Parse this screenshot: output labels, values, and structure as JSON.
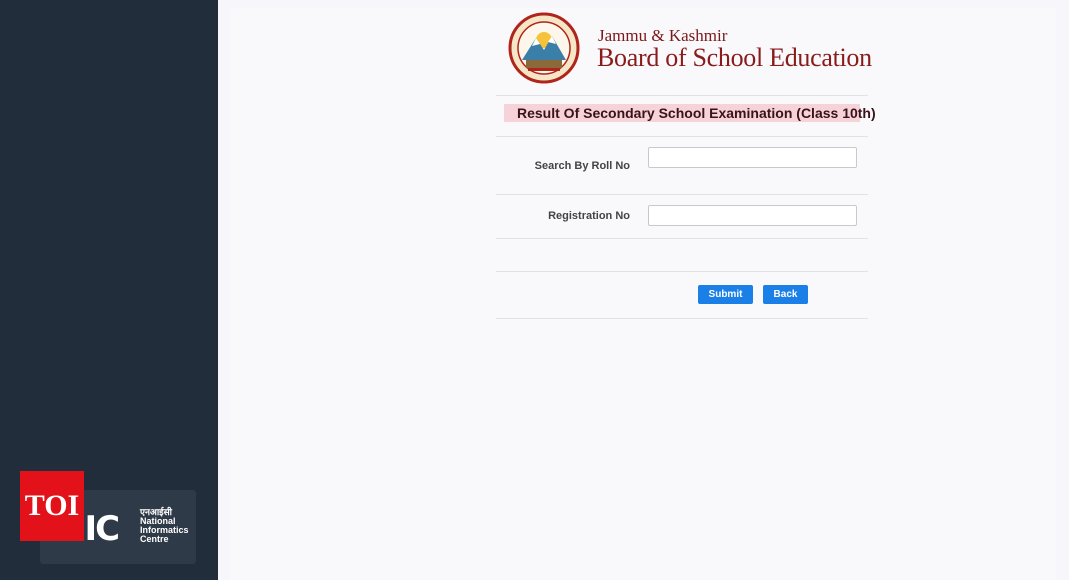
{
  "sidebar": {
    "nic": {
      "mark": "NIC",
      "hindi": "एनआईसी",
      "line1": "National",
      "line2": "Informatics",
      "line3": "Centre"
    },
    "watermark": "TOI"
  },
  "header": {
    "brand_top": "Jammu & Kashmir",
    "brand_main": "Board of School Education"
  },
  "page": {
    "title": "Result Of Secondary School Examination (Class 10th)"
  },
  "form": {
    "roll_label": "Search By Roll No",
    "roll_value": "",
    "registration_label": "Registration No",
    "registration_value": ""
  },
  "buttons": {
    "submit": "Submit",
    "back": "Back"
  },
  "colors": {
    "brand_red": "#8a1b1b",
    "sidebar_bg": "#222d3b",
    "button_blue": "#1a7fe6",
    "title_highlight": "#f6d2d9"
  }
}
